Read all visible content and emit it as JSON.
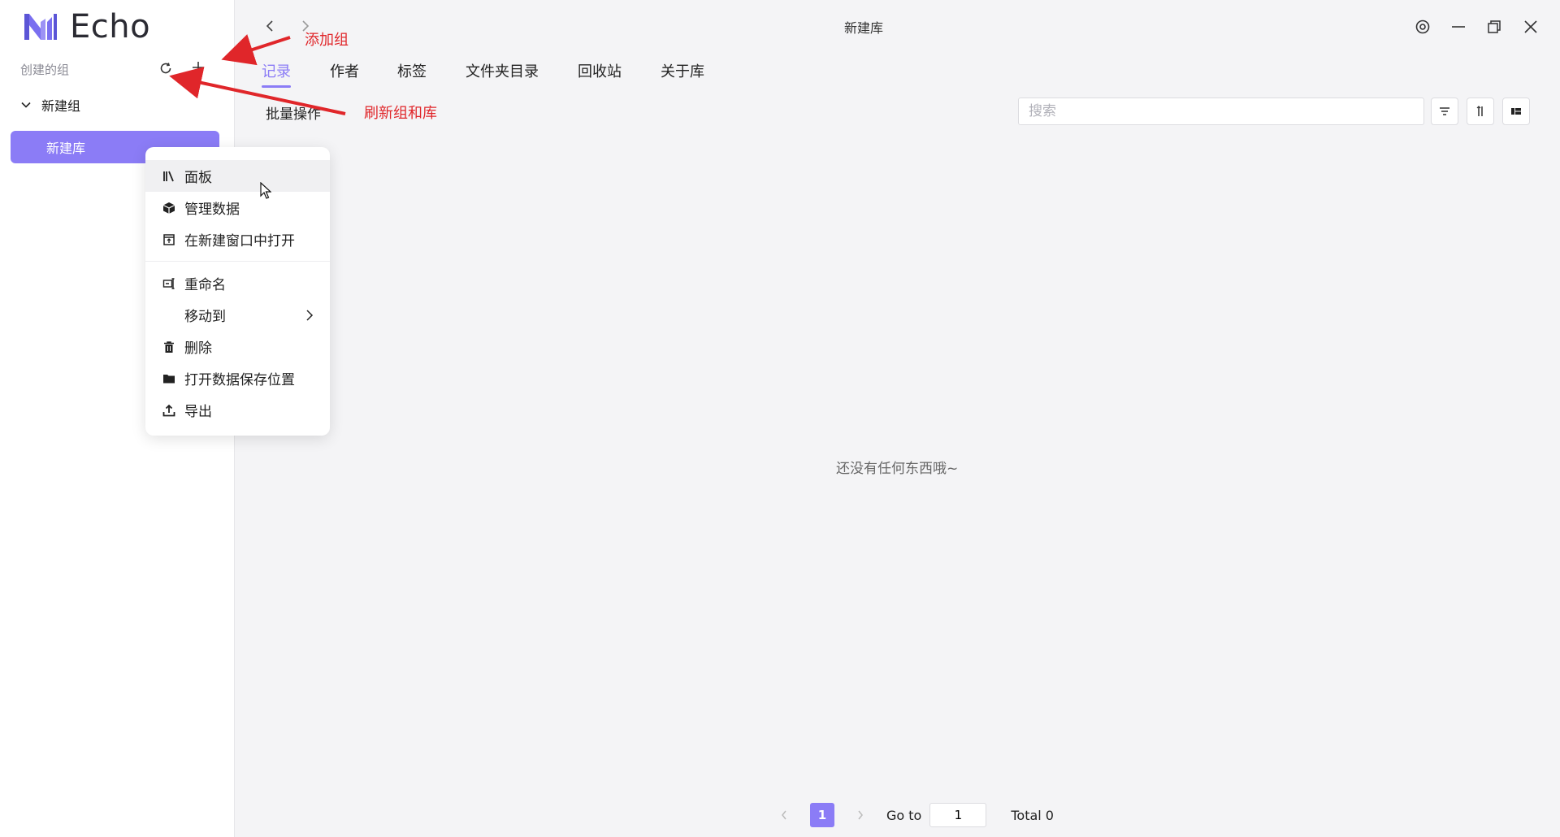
{
  "app": {
    "name": "Echo",
    "window_title": "新建库"
  },
  "sidebar": {
    "groups_label": "创建的组",
    "group": {
      "name": "新建组"
    },
    "library": {
      "name": "新建库"
    }
  },
  "tabs": [
    {
      "label": "记录",
      "active": true
    },
    {
      "label": "作者"
    },
    {
      "label": "标签"
    },
    {
      "label": "文件夹目录"
    },
    {
      "label": "回收站"
    },
    {
      "label": "关于库"
    }
  ],
  "toolbar": {
    "batch_label": "批量操作",
    "search_placeholder": "搜索"
  },
  "empty_text": "还没有任何东西哦~",
  "pagination": {
    "current_page": "1",
    "goto_label": "Go to",
    "goto_value": "1",
    "total_label": "Total 0"
  },
  "context_menu": {
    "items": [
      {
        "label": "面板",
        "icon": "panel-icon"
      },
      {
        "label": "管理数据",
        "icon": "cube-icon"
      },
      {
        "label": "在新建窗口中打开",
        "icon": "new-window-icon"
      },
      {
        "label": "重命名",
        "icon": "rename-icon"
      },
      {
        "label": "移动到",
        "icon": "none"
      },
      {
        "label": "删除",
        "icon": "trash-icon"
      },
      {
        "label": "打开数据保存位置",
        "icon": "folder-icon"
      },
      {
        "label": "导出",
        "icon": "export-icon"
      }
    ]
  },
  "annotations": {
    "add_group": "添加组",
    "refresh": "刷新组和库"
  },
  "colors": {
    "accent": "#8b7cf6",
    "annotation": "#e0262a"
  }
}
